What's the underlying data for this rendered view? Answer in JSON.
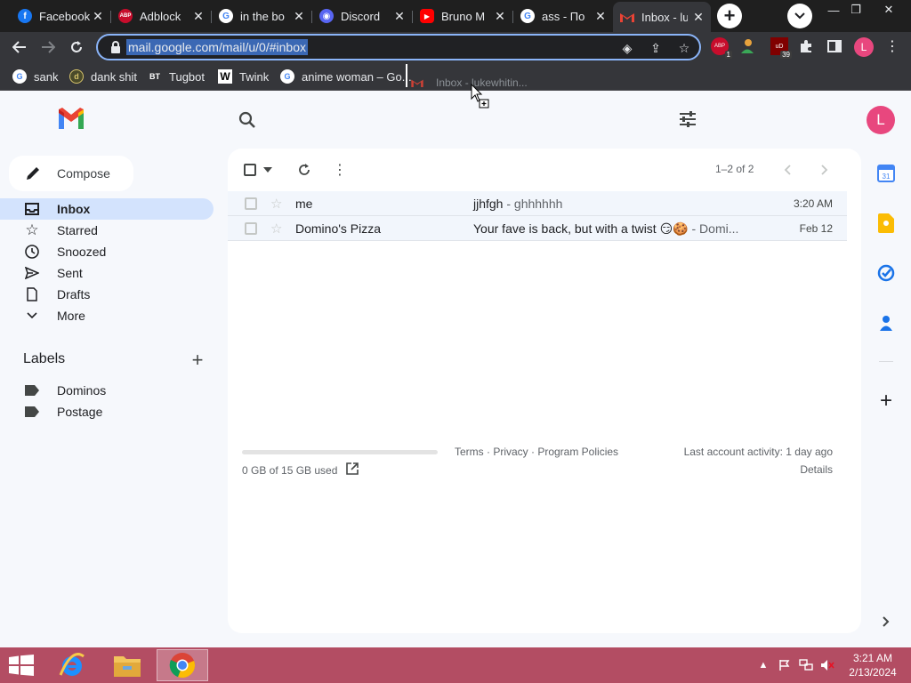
{
  "browser": {
    "tabs": [
      {
        "title": "Facebook",
        "icon": "facebook-icon",
        "color": "#1877f2",
        "glyph": "f"
      },
      {
        "title": "Adblock",
        "icon": "adblock-icon",
        "color": "#c70d2c",
        "glyph": "ABP"
      },
      {
        "title": "in the bo",
        "icon": "google-icon",
        "color": "#4285f4",
        "glyph": "G"
      },
      {
        "title": "Discord",
        "icon": "discord-icon",
        "color": "#5865f2",
        "glyph": "D"
      },
      {
        "title": "Bruno M",
        "icon": "youtube-icon",
        "color": "#ff0000",
        "glyph": "▶"
      },
      {
        "title": "ass - По",
        "icon": "google-icon",
        "color": "#4285f4",
        "glyph": "G"
      },
      {
        "title": "Inbox - lu",
        "icon": "gmail-icon",
        "color": "#ea4335",
        "glyph": "M",
        "active": true
      }
    ],
    "url": "mail.google.com/mail/u/0/#inbox",
    "profile_initial": "L",
    "extensions": [
      {
        "name": "abp-extension-icon",
        "badge": "1",
        "color": "#c70d2c",
        "glyph": "ABP"
      },
      {
        "name": "extension-person-icon",
        "badge": "",
        "color": "#e8a33d",
        "glyph": "●"
      },
      {
        "name": "ublock-extension-icon",
        "badge": "39",
        "color": "#800000",
        "glyph": "uD"
      }
    ],
    "bookmarks": [
      {
        "label": "sank",
        "icon": "google-icon"
      },
      {
        "label": "dank shit",
        "icon": "dank-icon"
      },
      {
        "label": "Tugbot",
        "icon": "tugbot-icon"
      },
      {
        "label": "Twink",
        "icon": "w-icon"
      },
      {
        "label": "anime woman – Go...",
        "icon": "google-icon"
      }
    ],
    "drag_ghost_label": "Inbox - lukewhitin..."
  },
  "gmail": {
    "compose_label": "Compose",
    "nav": [
      {
        "label": "Inbox",
        "icon": "inbox-icon",
        "active": true
      },
      {
        "label": "Starred",
        "icon": "star-icon"
      },
      {
        "label": "Snoozed",
        "icon": "clock-icon"
      },
      {
        "label": "Sent",
        "icon": "send-icon"
      },
      {
        "label": "Drafts",
        "icon": "draft-icon"
      },
      {
        "label": "More",
        "icon": "chevron-down-icon"
      }
    ],
    "labels_title": "Labels",
    "labels": [
      "Dominos",
      "Postage"
    ],
    "pager": "1–2 of 2",
    "emails": [
      {
        "from": "me",
        "subject": "jjhfgh",
        "snippet": " - ghhhhhh",
        "date": "3:20 AM"
      },
      {
        "from": "Domino's Pizza",
        "subject": "Your fave is back, but with a twist 😏🍪",
        "snippet": " - Domi...",
        "date": "Feb 12"
      }
    ],
    "storage_text": "0 GB of 15 GB used",
    "storage_fraction": 0.0,
    "footer_links": "Terms · Privacy · Program Policies",
    "last_activity": "Last account activity: 1 day ago",
    "details": "Details",
    "profile_initial": "L"
  },
  "taskbar": {
    "time": "3:21 AM",
    "date": "2/13/2024",
    "apps": [
      "ie-icon",
      "file-explorer-icon",
      "chrome-icon"
    ]
  },
  "colors": {
    "gmail_active_nav": "#d3e3fd",
    "omnibox_focus": "#8ab4f8",
    "avatar": "#e8477e",
    "taskbar": "#b34d63"
  }
}
